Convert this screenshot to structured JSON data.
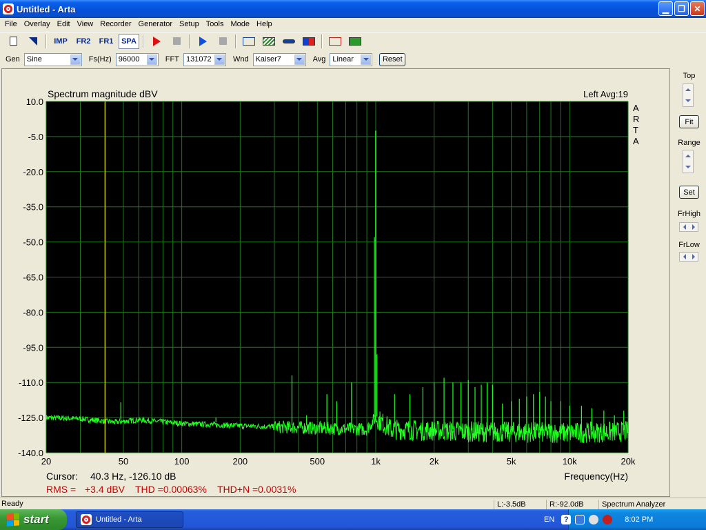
{
  "window": {
    "title": "Untitled - Arta"
  },
  "menu": [
    "File",
    "Overlay",
    "Edit",
    "View",
    "Recorder",
    "Generator",
    "Setup",
    "Tools",
    "Mode",
    "Help"
  ],
  "toolbar": {
    "imp": "IMP",
    "fr2": "FR2",
    "fr1": "FR1",
    "spa": "SPA"
  },
  "controls": {
    "gen_label": "Gen",
    "gen_value": "Sine",
    "fs_label": "Fs(Hz)",
    "fs_value": "96000",
    "fft_label": "FFT",
    "fft_value": "131072",
    "wnd_label": "Wnd",
    "wnd_value": "Kaiser7",
    "avg_label": "Avg",
    "avg_value": "Linear",
    "reset_label": "Reset"
  },
  "side_panel": {
    "top_label": "Top",
    "fit_label": "Fit",
    "range_label": "Range",
    "set_label": "Set",
    "frhigh_label": "FrHigh",
    "frlow_label": "FrLow"
  },
  "plot": {
    "title": "Spectrum magnitude dBV",
    "channel_info": "Left  Avg:19",
    "watermark": [
      "A",
      "R",
      "T",
      "A"
    ],
    "cursor_label": "Cursor:",
    "cursor_value": "40.3 Hz, -126.10 dB",
    "rms_label": "RMS =",
    "rms_value": "+3.4 dBV",
    "thd_text": "THD =0.00063%",
    "thdn_text": "THD+N =0.0031%",
    "colors": {
      "background": "#000000",
      "grid": "#1E7A1E",
      "trace": "#22FF22",
      "cursor": "#D8D800",
      "metrics": "#CC0000"
    }
  },
  "chart_data": {
    "type": "line",
    "title": "Spectrum magnitude dBV",
    "xlabel": "Frequency(Hz)",
    "ylabel": "",
    "x_scale": "log",
    "xlim": [
      20,
      20000
    ],
    "ylim": [
      -140,
      10
    ],
    "grid": true,
    "x_ticks": [
      {
        "value": 20,
        "label": "20"
      },
      {
        "value": 50,
        "label": "50"
      },
      {
        "value": 100,
        "label": "100"
      },
      {
        "value": 200,
        "label": "200"
      },
      {
        "value": 500,
        "label": "500"
      },
      {
        "value": 1000,
        "label": "1k"
      },
      {
        "value": 2000,
        "label": "2k"
      },
      {
        "value": 5000,
        "label": "5k"
      },
      {
        "value": 10000,
        "label": "10k"
      },
      {
        "value": 20000,
        "label": "20k"
      }
    ],
    "y_ticks": [
      {
        "value": 10,
        "label": "10.0"
      },
      {
        "value": -5,
        "label": "-5.0"
      },
      {
        "value": -20,
        "label": "-20.0"
      },
      {
        "value": -35,
        "label": "-35.0"
      },
      {
        "value": -50,
        "label": "-50.0"
      },
      {
        "value": -65,
        "label": "-65.0"
      },
      {
        "value": -80,
        "label": "-80.0"
      },
      {
        "value": -95,
        "label": "-95.0"
      },
      {
        "value": -110,
        "label": "-110.0"
      },
      {
        "value": -125,
        "label": "-125.0"
      },
      {
        "value": -140,
        "label": "-140.0"
      }
    ],
    "cursor_hz": 40.3,
    "fundamental": {
      "hz": 1000,
      "dbv": -2.5
    },
    "peaks": [
      {
        "hz": 48.5,
        "dbv": -118.5
      },
      {
        "hz": 150,
        "dbv": -125
      },
      {
        "hz": 370,
        "dbv": -107
      },
      {
        "hz": 440,
        "dbv": -124
      },
      {
        "hz": 560,
        "dbv": -115
      },
      {
        "hz": 630,
        "dbv": -118
      },
      {
        "hz": 750,
        "dbv": -110
      },
      {
        "hz": 985,
        "dbv": -48
      },
      {
        "hz": 1015,
        "dbv": -98
      },
      {
        "hz": 1250,
        "dbv": -115
      },
      {
        "hz": 1500,
        "dbv": -115
      },
      {
        "hz": 1750,
        "dbv": -112
      },
      {
        "hz": 2000,
        "dbv": -110
      },
      {
        "hz": 2250,
        "dbv": -108
      },
      {
        "hz": 2500,
        "dbv": -110
      },
      {
        "hz": 2750,
        "dbv": -110
      },
      {
        "hz": 3000,
        "dbv": -109
      },
      {
        "hz": 3250,
        "dbv": -112
      },
      {
        "hz": 3500,
        "dbv": -111
      },
      {
        "hz": 3750,
        "dbv": -110
      },
      {
        "hz": 4000,
        "dbv": -111
      },
      {
        "hz": 4500,
        "dbv": -119
      },
      {
        "hz": 5000,
        "dbv": -118
      },
      {
        "hz": 5500,
        "dbv": -117
      },
      {
        "hz": 6000,
        "dbv": -116
      },
      {
        "hz": 6500,
        "dbv": -115
      },
      {
        "hz": 7000,
        "dbv": -114
      },
      {
        "hz": 7500,
        "dbv": -116
      },
      {
        "hz": 8000,
        "dbv": -118
      },
      {
        "hz": 9000,
        "dbv": -118
      },
      {
        "hz": 10000,
        "dbv": -120
      },
      {
        "hz": 11500,
        "dbv": -120
      },
      {
        "hz": 13000,
        "dbv": -121
      },
      {
        "hz": 15000,
        "dbv": -122
      },
      {
        "hz": 17000,
        "dbv": -124
      },
      {
        "hz": 19000,
        "dbv": -122
      }
    ],
    "noise_floor": [
      {
        "hz": 20,
        "dbv": -125
      },
      {
        "hz": 30,
        "dbv": -125.5
      },
      {
        "hz": 45,
        "dbv": -127
      },
      {
        "hz": 60,
        "dbv": -126
      },
      {
        "hz": 100,
        "dbv": -127.5
      },
      {
        "hz": 200,
        "dbv": -128.5
      },
      {
        "hz": 500,
        "dbv": -129.5
      },
      {
        "hz": 900,
        "dbv": -130
      },
      {
        "hz": 1000,
        "dbv": -125
      },
      {
        "hz": 1200,
        "dbv": -130
      },
      {
        "hz": 3000,
        "dbv": -131
      },
      {
        "hz": 10000,
        "dbv": -131.5
      },
      {
        "hz": 20000,
        "dbv": -131
      }
    ]
  },
  "statusbar": {
    "ready": "Ready",
    "left_level": "L:-3.5dB",
    "right_level": "R:-92.0dB",
    "mode": "Spectrum Analyzer"
  },
  "taskbar": {
    "start_label": "start",
    "task_label": "Untitled - Arta",
    "lang": "EN",
    "clock": "8:02 PM"
  }
}
